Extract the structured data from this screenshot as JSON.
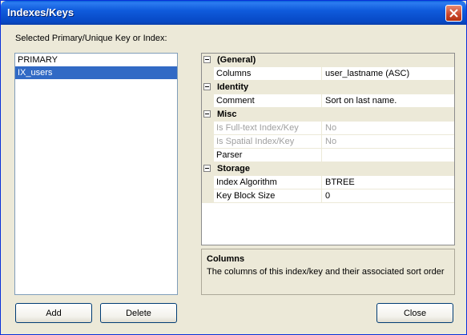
{
  "window": {
    "title": "Indexes/Keys"
  },
  "labels": {
    "selected_key_label": "Selected Primary/Unique Key or Index:"
  },
  "keys_list": {
    "items": [
      {
        "label": "PRIMARY",
        "selected": false
      },
      {
        "label": "IX_users",
        "selected": true
      }
    ]
  },
  "buttons": {
    "add": "Add",
    "delete": "Delete",
    "close": "Close"
  },
  "properties": {
    "categories": [
      {
        "label": "(General)",
        "rows": [
          {
            "name": "Columns",
            "value": "user_lastname (ASC)",
            "disabled": false
          }
        ]
      },
      {
        "label": "Identity",
        "rows": [
          {
            "name": "Comment",
            "value": "Sort on last name.",
            "disabled": false
          }
        ]
      },
      {
        "label": "Misc",
        "rows": [
          {
            "name": "Is Full-text Index/Key",
            "value": "No",
            "disabled": true
          },
          {
            "name": "Is Spatial Index/Key",
            "value": "No",
            "disabled": true
          },
          {
            "name": "Parser",
            "value": "",
            "disabled": false
          }
        ]
      },
      {
        "label": "Storage",
        "rows": [
          {
            "name": "Index Algorithm",
            "value": "BTREE",
            "disabled": false
          },
          {
            "name": "Key Block Size",
            "value": "0",
            "disabled": false
          }
        ]
      }
    ]
  },
  "description": {
    "title": "Columns",
    "text": "The columns of this index/key and their associated sort order"
  },
  "colors": {
    "titlebar": "#0a5fd8",
    "selection": "#316ac5",
    "dialog_bg": "#ece9d8"
  }
}
